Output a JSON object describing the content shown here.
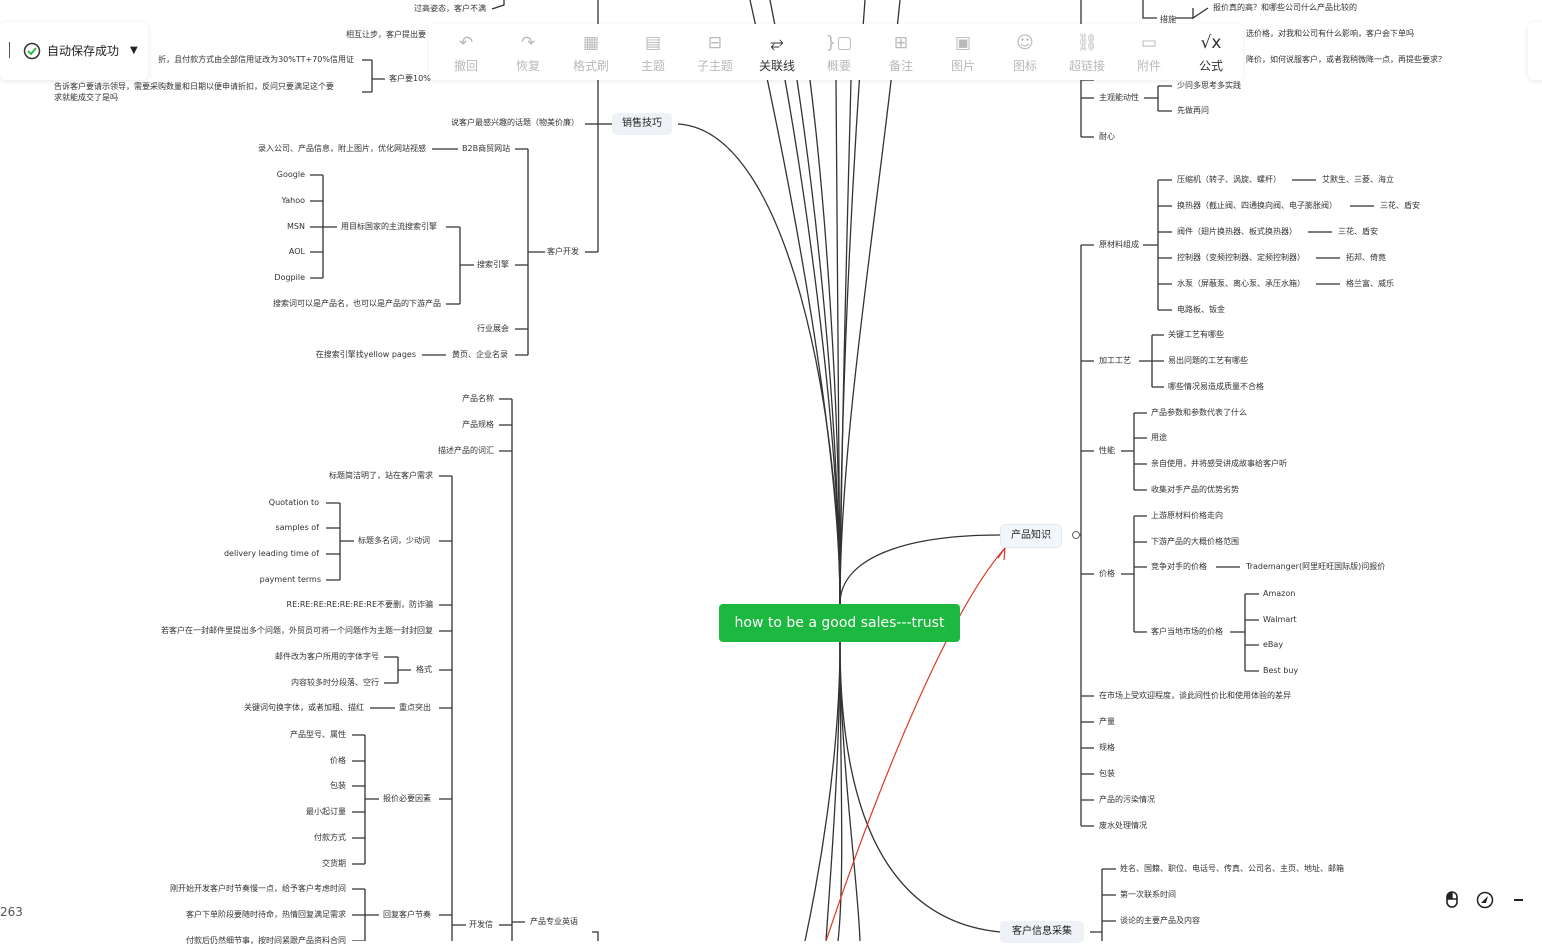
{
  "save_status": {
    "label": "自动保存成功"
  },
  "toolbar": {
    "undo": "撤回",
    "redo": "恢复",
    "format_brush": "格式刷",
    "topic": "主题",
    "subtopic": "子主题",
    "relation": "关联线",
    "summary": "概要",
    "note": "备注",
    "image": "图片",
    "icon": "图标",
    "hyperlink": "超链接",
    "attachment": "附件",
    "formula": "公式"
  },
  "zoom_partial": "263",
  "central": "how to be a good sales---trust",
  "branches": {
    "sales": "销售技巧",
    "product": "产品知识",
    "info": "客户信息采集"
  },
  "left_top": {
    "l1": "过高姿态，客户不满",
    "l2": "相互让步，客户提出要",
    "l3": "折，且付款方式由全部信用证改为30%TT+70%信用证",
    "l4": "客户要10%",
    "l5": "告诉客户要请示领导，需要采购数量和日期以便申请折扣，反问只要满足这个要",
    "l6": "求就能成交了是吗",
    "l7": "说客户最感兴趣的话题（物美价廉）"
  },
  "dev": {
    "customer_dev": "客户开发",
    "b2b": "B2B商贸网站",
    "b2b_note": "录入公司、产品信息，附上图片，优化网站视感",
    "engines": [
      "Google",
      "Yahoo",
      "MSN",
      "AOL",
      "Dogpile"
    ],
    "use_engine": "用目标国家的主流搜索引擎",
    "search_engine": "搜索引擎",
    "keyword": "搜索词可以是产品名，也可以是产品的下游产品",
    "expo": "行业展会",
    "yellow": "在搜索引擎找yellow pages",
    "yellow_parent": "黄页、企业名录"
  },
  "english": {
    "label": "产品专业英语",
    "product_name": "产品名称",
    "product_spec": "产品规格",
    "desc": "描述产品的词汇",
    "dev_letter": "开发信",
    "title_clear": "标题简洁明了，站在客户需求",
    "q": "Quotation to",
    "s": "samples of",
    "d": "delivery leading time of",
    "p": "payment terms",
    "title_noun": "标题多名词，少动词",
    "re": "RE:RE:RE:RE:RE:RE:RE不要删，防诈骗",
    "multi": "若客户在一封邮件里提出多个问题，外贸员可将一个问题作为主题一封封回复",
    "font": "邮件改为客户所用的字体字号",
    "para": "内容较多时分段落、空行",
    "format": "格式",
    "key": "关键词句换字体，或者加粗、描红",
    "emph": "重点突出",
    "model": "产品型号、属性",
    "price": "价格",
    "pack": "包装",
    "moq": "最小起订量",
    "pay": "付款方式",
    "lead": "交货期",
    "quote_need": "报价必要因素",
    "slow": "刚开始开发客户时节奏慢一点，给予客户考虑时间",
    "wait": "客户下单阶段要随时待命，热情回复满足需求",
    "pace": "回复客户节奏",
    "cut": "付款后仍然细节事，按时间紧跟产品资料合同"
  },
  "right_top": {
    "r1": "报价真的高？和哪些公司什么产品比较的",
    "r2": "选价格，对我和公司有什么影响，客户会下单吗",
    "r3": "降价，如何说服客户，或者我稍微降一点，再提些要求？",
    "cut": "措施",
    "proactive": "主观能动性",
    "p1": "少问多思考多实践",
    "p2": "先做再问",
    "patience": "耐心"
  },
  "product": {
    "materials": "原材料组成",
    "compressor": "压缩机（转子、涡旋、螺杆）",
    "compressor_s": "艾默生、三菱、海立",
    "exchanger": "换热器（截止阀、四通换向阀、电子膨胀阀）",
    "exchanger_s": "三花、盾安",
    "valve": "阀件（翅片换热器、板式换热器）",
    "valve_s": "三花、盾安",
    "controller": "控制器（变频控制器、定频控制器）",
    "controller_s": "拓邦、倚竟",
    "pump": "水泵（屏蔽泵、离心泵、承压水箱）",
    "pump_s": "格兰富、威乐",
    "board": "电路板、钣金",
    "process": "加工工艺",
    "pr1": "关键工艺有哪些",
    "pr2": "易出问题的工艺有哪些",
    "pr3": "哪些情况易造成质量不合格",
    "perf": "性能",
    "pf1": "产品参数和参数代表了什么",
    "pf2": "用途",
    "pf3": "亲自使用，并将感受讲成故事给客户听",
    "pf4": "收集对手产品的优势劣势",
    "price": "价格",
    "pc1": "上游原材料价格走向",
    "pc2": "下游产品的大概价格范围",
    "pc3": "竞争对手的价格",
    "pc3s": "Trademanger(阿里旺旺国际版)问报价",
    "pc4": "客户当地市场的价格",
    "shops": [
      "Amazon",
      "Walmart",
      "eBay",
      "Best buy"
    ],
    "popular": "在市场上受欢迎程度，谈此间性价比和使用体验的差异",
    "output": "产量",
    "spec": "规格",
    "pack": "包装",
    "pollution": "产品的污染情况",
    "waste": "废水处理情况"
  },
  "info": {
    "i1": "姓名、国籍、职位、电话号、传真、公司名、主页、地址、邮箱",
    "i2": "第一次联系时间",
    "i3": "谈论的主要产品及内容"
  }
}
